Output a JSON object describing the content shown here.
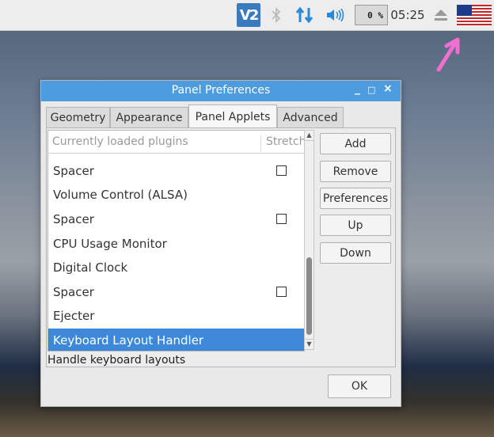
{
  "taskbar": {
    "vnc_label": "V2",
    "cpu_text": "0 %",
    "clock": "05:25",
    "icons": [
      "vnc-icon",
      "bluetooth-icon",
      "network-icon",
      "volume-icon",
      "eject-icon",
      "us-flag-icon"
    ]
  },
  "window": {
    "title": "Panel Preferences",
    "tabs": [
      "Geometry",
      "Appearance",
      "Panel Applets",
      "Advanced"
    ],
    "active_tab": "Panel Applets",
    "list": {
      "header_plugins": "Currently loaded plugins",
      "header_stretch": "Stretch",
      "rows": [
        {
          "label": "Spacer",
          "stretch": false
        },
        {
          "label": "Volume Control (ALSA)",
          "stretch": null
        },
        {
          "label": "Spacer",
          "stretch": false
        },
        {
          "label": "CPU Usage Monitor",
          "stretch": null
        },
        {
          "label": "Digital Clock",
          "stretch": null
        },
        {
          "label": "Spacer",
          "stretch": false
        },
        {
          "label": "Ejecter",
          "stretch": null
        },
        {
          "label": "Keyboard Layout Handler",
          "stretch": null,
          "selected": true
        }
      ]
    },
    "buttons": {
      "add": "Add",
      "remove": "Remove",
      "preferences": "Preferences",
      "up": "Up",
      "down": "Down",
      "ok": "OK"
    },
    "description": "Handle keyboard layouts"
  },
  "colors": {
    "titlebar": "#4d9ce0",
    "selection": "#3d88d8",
    "annotation_arrow": "#f06fd0"
  }
}
